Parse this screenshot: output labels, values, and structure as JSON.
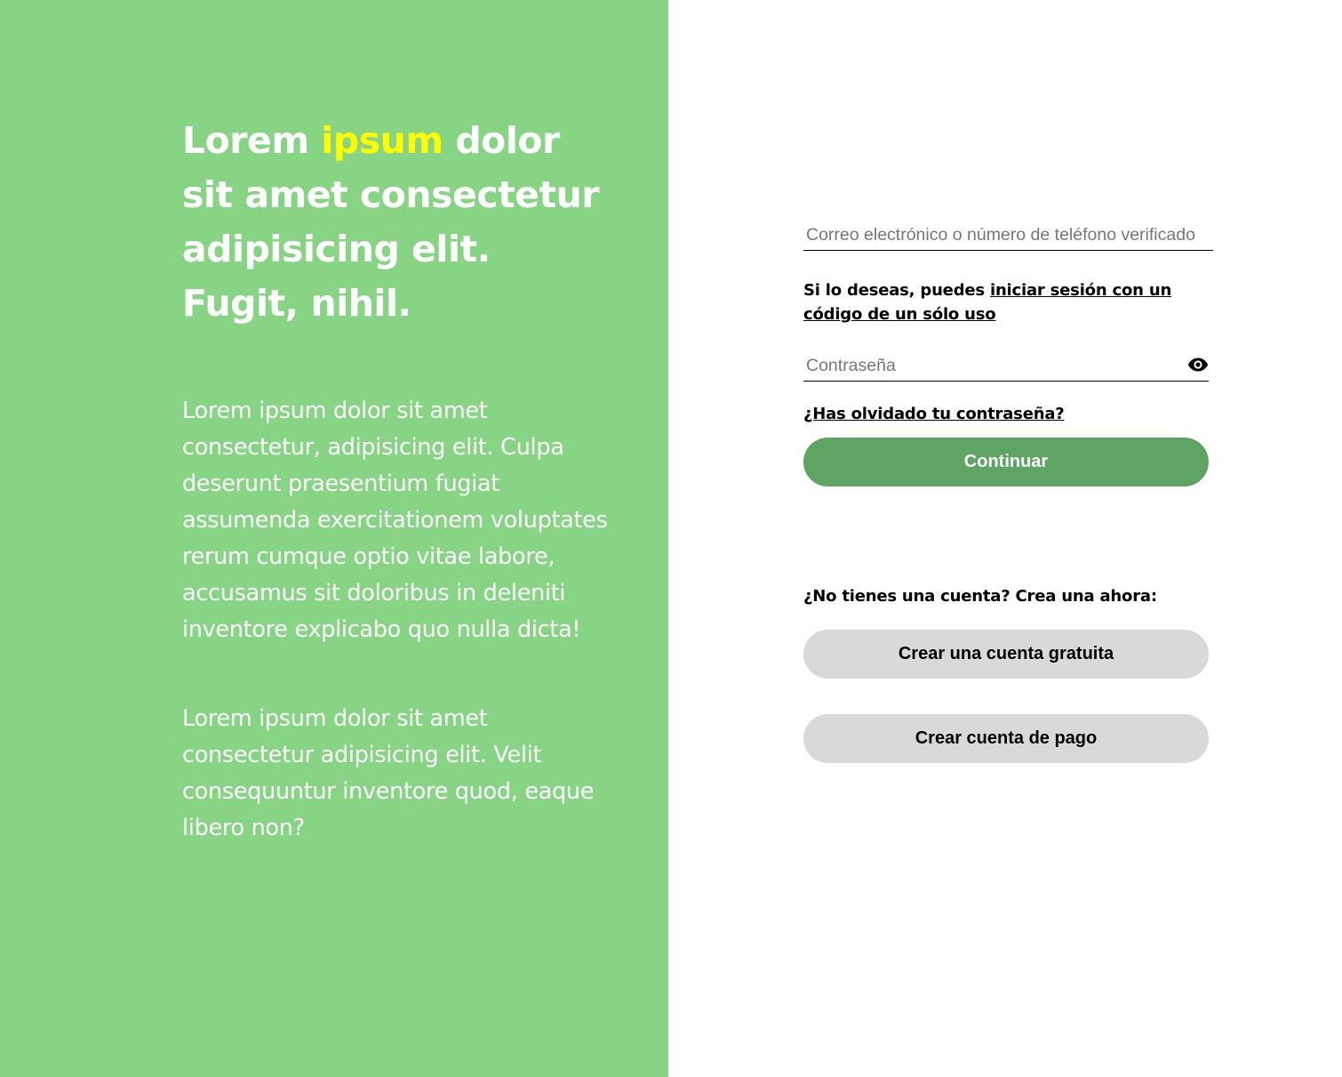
{
  "colors": {
    "left_panel_bg": "#86d484",
    "headline_accent": "#ffff00",
    "primary_button_bg": "#5ea462",
    "secondary_button_bg": "#d9dad8"
  },
  "hero": {
    "headline_start": "Lorem ",
    "headline_accent": "ipsum",
    "headline_end": " dolor sit amet consectetur adipisicing elit. Fugit, nihil.",
    "paragraph_1": "Lorem ipsum dolor sit amet consectetur, adipisicing elit. Culpa deserunt praesentium fugiat assumenda exercitationem voluptates rerum cumque optio vitae labore, accusamus sit doloribus in deleniti inventore explicabo quo nulla dicta!",
    "paragraph_2": "Lorem ipsum dolor sit amet consectetur adipisicing elit. Velit consequuntur inventore quod, eaque libero non?"
  },
  "login": {
    "email_placeholder": "Correo electrónico o número de teléfono verificado",
    "email_value": "",
    "otp_hint_prefix": "Si lo deseas, puedes ",
    "otp_link": "iniciar sesión con un código de un sólo uso",
    "password_placeholder": "Contraseña",
    "password_value": "",
    "password_toggle_icon": "eye-icon",
    "forgot_password": "¿Has olvidado tu contraseña?",
    "continue_label": "Continuar"
  },
  "signup": {
    "prompt": "¿No tienes una cuenta? Crea una ahora:",
    "free_account_label": "Crear una cuenta gratuita",
    "paid_account_label": "Crear cuenta de pago"
  }
}
